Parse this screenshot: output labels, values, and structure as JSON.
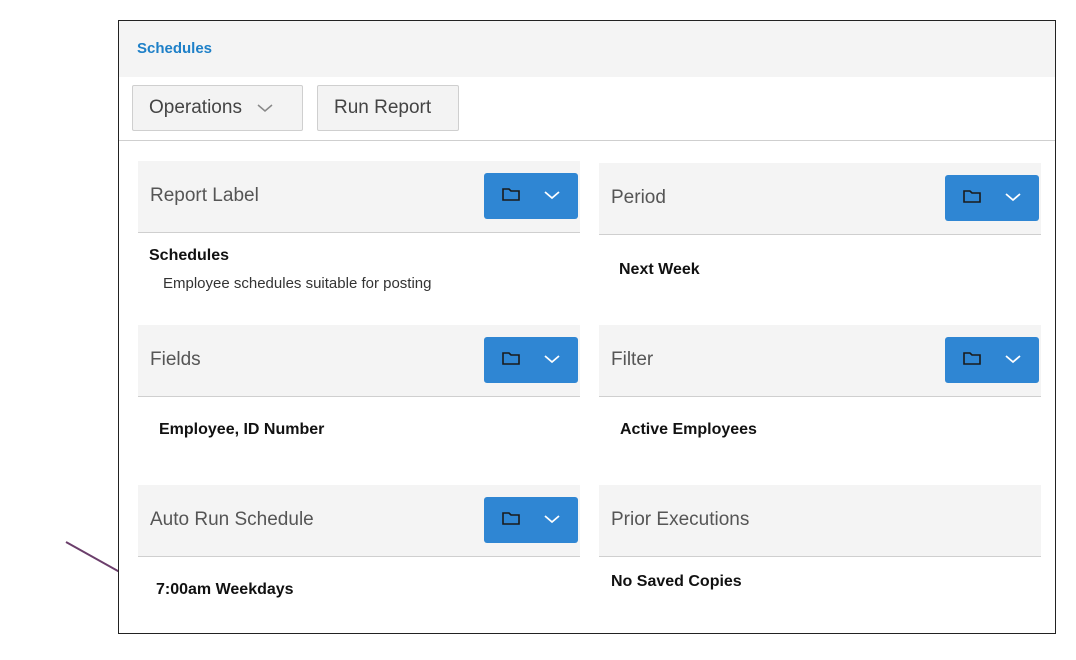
{
  "window": {
    "title": "Schedules"
  },
  "toolbar": {
    "operations_label": "Operations",
    "run_report_label": "Run Report"
  },
  "panels": {
    "report_label": {
      "header": "Report Label",
      "value": "Schedules",
      "description": "Employee schedules suitable for posting"
    },
    "period": {
      "header": "Period",
      "value": "Next Week"
    },
    "fields": {
      "header": "Fields",
      "value": "Employee, ID Number"
    },
    "filter": {
      "header": "Filter",
      "value": "Active Employees"
    },
    "auto_run": {
      "header": "Auto Run Schedule",
      "value": "7:00am Weekdays"
    },
    "prior_executions": {
      "header": "Prior Executions",
      "value": "No Saved Copies"
    }
  },
  "icons": {
    "panel_button": [
      "folder-icon",
      "chevron-down-icon"
    ],
    "operations": "chevron-down-icon",
    "annotation": "arrow-icon"
  },
  "colors": {
    "accent": "#2f86d3",
    "title": "#1e80c8",
    "annotation_arrow": "#6b3e6b"
  }
}
